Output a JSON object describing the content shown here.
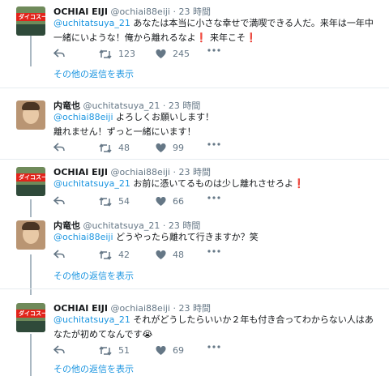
{
  "tweets": [
    {
      "author": "OCHIAI EIJI",
      "handle": "@ochiai88eiji",
      "dot": "·",
      "time": "23 時間",
      "avatar_text": "ダイコスーム",
      "text_parts": [
        {
          "t": "@uchitatsuya_21",
          "kind": "mention"
        },
        {
          "t": " あなたは本当に小さな幸せで満喫できる人だ。来年は一年中一緒にいような！俺から離れるなよ",
          "kind": "text"
        },
        {
          "t": "❗",
          "kind": "red"
        },
        {
          "t": " 来年こそ",
          "kind": "text"
        },
        {
          "t": "❗",
          "kind": "red"
        }
      ],
      "retweets": "123",
      "likes": "245",
      "more_label": "その他の返信を表示"
    },
    {
      "author": "内竜也",
      "handle": "@uchitatsuya_21",
      "dot": "·",
      "time": "23 時間",
      "text_parts": [
        {
          "t": "@ochiai88eiji",
          "kind": "mention"
        },
        {
          "t": " よろしくお願いします！\n離れません！ずっと一緒にいます！",
          "kind": "text"
        }
      ],
      "retweets": "48",
      "likes": "99"
    },
    {
      "author": "OCHIAI EIJI",
      "handle": "@ochiai88eiji",
      "dot": "·",
      "time": "23 時間",
      "avatar_text": "ダイコスーム",
      "text_parts": [
        {
          "t": "@uchitatsuya_21",
          "kind": "mention"
        },
        {
          "t": " お前に憑いてるものは少し離れさせろよ",
          "kind": "text"
        },
        {
          "t": "❗",
          "kind": "red"
        }
      ],
      "retweets": "54",
      "likes": "66"
    },
    {
      "author": "内竜也",
      "handle": "@uchitatsuya_21",
      "dot": "·",
      "time": "23 時間",
      "text_parts": [
        {
          "t": "@ochiai88eiji",
          "kind": "mention"
        },
        {
          "t": " どうやったら離れて行きますか？笑",
          "kind": "text"
        }
      ],
      "retweets": "42",
      "likes": "48",
      "more_label": "その他の返信を表示"
    },
    {
      "author": "OCHIAI EIJI",
      "handle": "@ochiai88eiji",
      "dot": "·",
      "time": "23 時間",
      "avatar_text": "ダイコスーム",
      "text_parts": [
        {
          "t": "@uchitatsuya_21",
          "kind": "mention"
        },
        {
          "t": " それがどうしたらいいか２年も付き合ってわからない人はあなたが初めてなんです😭",
          "kind": "text"
        }
      ],
      "retweets": "51",
      "likes": "69",
      "more_label": "その他の返信を表示"
    }
  ],
  "colors": {
    "link": "#1b95e0",
    "muted": "#657786",
    "thread_line": "#aab8c2",
    "separator": "#e6ecf0",
    "emoji_red": "#e0245e"
  },
  "icons": {
    "reply": "reply-icon",
    "retweet": "retweet-icon",
    "like": "heart-icon",
    "more": "more-dots-icon"
  }
}
